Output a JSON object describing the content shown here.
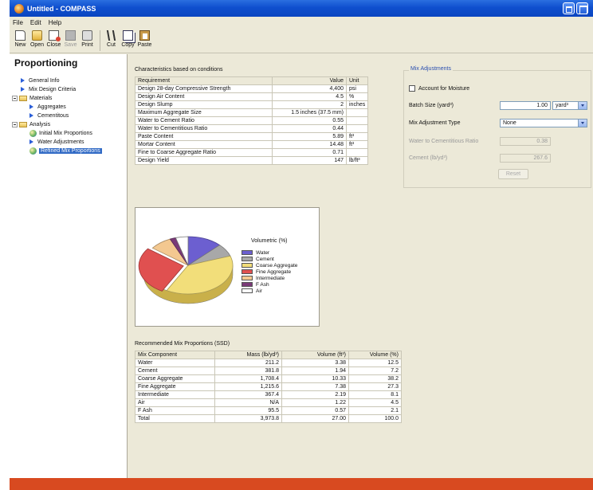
{
  "window": {
    "title": "Untitled - COMPASS"
  },
  "menu": [
    "File",
    "Edit",
    "Help"
  ],
  "toolbar": [
    {
      "label": "New",
      "icon": "new-icon",
      "enabled": true
    },
    {
      "label": "Open",
      "icon": "open-icon",
      "enabled": true
    },
    {
      "label": "Close",
      "icon": "close-icon",
      "enabled": true
    },
    {
      "label": "Save",
      "icon": "save-icon",
      "enabled": false
    },
    {
      "label": "Print",
      "icon": "print-icon",
      "enabled": true
    },
    {
      "label": "Cut",
      "icon": "cut-icon",
      "enabled": true
    },
    {
      "label": "Copy",
      "icon": "copy-icon",
      "enabled": true
    },
    {
      "label": "Paste",
      "icon": "paste-icon",
      "enabled": true
    }
  ],
  "sidebar": {
    "title": "Proportioning",
    "items": [
      {
        "label": "General Info"
      },
      {
        "label": "Mix Design Criteria"
      },
      {
        "label": "Materials"
      },
      {
        "label": "Aggregates"
      },
      {
        "label": "Cementitous"
      },
      {
        "label": "Analysis"
      },
      {
        "label": "Initial Mix Proportions"
      },
      {
        "label": "Water Adjustments"
      },
      {
        "label": "Refined Mix Proportions",
        "selected": true
      }
    ]
  },
  "characteristics": {
    "heading": "Characteristics based on conditions",
    "columns": [
      "Requirement",
      "Value",
      "Unit"
    ],
    "rows": [
      [
        "Design 28-day Compressive Strength",
        "4,400",
        "psi"
      ],
      [
        "Design Air Content",
        "4.5",
        "%"
      ],
      [
        "Design Slump",
        "2",
        "inches"
      ],
      [
        "Maximum Aggregate Size",
        "1.5 inches (37.5 mm)",
        ""
      ],
      [
        "Water to Cement Ratio",
        "0.55",
        ""
      ],
      [
        "Water to Cementitious Ratio",
        "0.44",
        ""
      ],
      [
        "Paste Content",
        "5.89",
        "ft³"
      ],
      [
        "Mortar Content",
        "14.48",
        "ft³"
      ],
      [
        "Fine to Coarse Aggregate Ratio",
        "0.71",
        ""
      ],
      [
        "Design Yield",
        "147",
        "lb/ft³"
      ]
    ]
  },
  "mix_adjustments": {
    "title": "Mix Adjustments",
    "moisture_label": "Account for Moisture",
    "batch_label": "Batch Size (yard³)",
    "batch_value": "1.00",
    "batch_unit": "yard³",
    "type_label": "Mix Adjustment Type",
    "type_value": "None",
    "wc_label": "Water to Cementitious Ratio",
    "wc_value": "0.38",
    "cement_label": "Cement (lb/yd³)",
    "cement_value": "267.6",
    "reset_label": "Reset"
  },
  "chart_data": {
    "type": "pie",
    "title": "Volumetric (%)",
    "categories": [
      "Water",
      "Cement",
      "Coarse Aggregate",
      "Fine Aggregate",
      "Intermediate",
      "F Ash",
      "Air"
    ],
    "values": [
      12.5,
      7.2,
      38.2,
      27.3,
      8.1,
      2.1,
      4.5
    ],
    "colors": [
      "#6c5fd0",
      "#a8a8a8",
      "#f2de7a",
      "#e05050",
      "#f3c890",
      "#7a3a78",
      "#ffffff"
    ]
  },
  "recommended": {
    "heading": "Recommended Mix Proportions (SSD)",
    "columns": [
      "Mix Component",
      "Mass (lb/yd³)",
      "Volume (ft³)",
      "Volume (%)"
    ],
    "rows": [
      [
        "Water",
        "211.2",
        "3.38",
        "12.5"
      ],
      [
        "Cement",
        "381.8",
        "1.94",
        "7.2"
      ],
      [
        "Coarse Aggregate",
        "1,708.4",
        "10.33",
        "38.2"
      ],
      [
        "Fine Aggregate",
        "1,215.6",
        "7.38",
        "27.3"
      ],
      [
        "Intermediate",
        "367.4",
        "2.19",
        "8.1"
      ],
      [
        "Air",
        "N/A",
        "1.22",
        "4.5"
      ],
      [
        "F Ash",
        "95.5",
        "0.57",
        "2.1"
      ],
      [
        "Total",
        "3,973.8",
        "27.00",
        "100.0"
      ]
    ]
  }
}
